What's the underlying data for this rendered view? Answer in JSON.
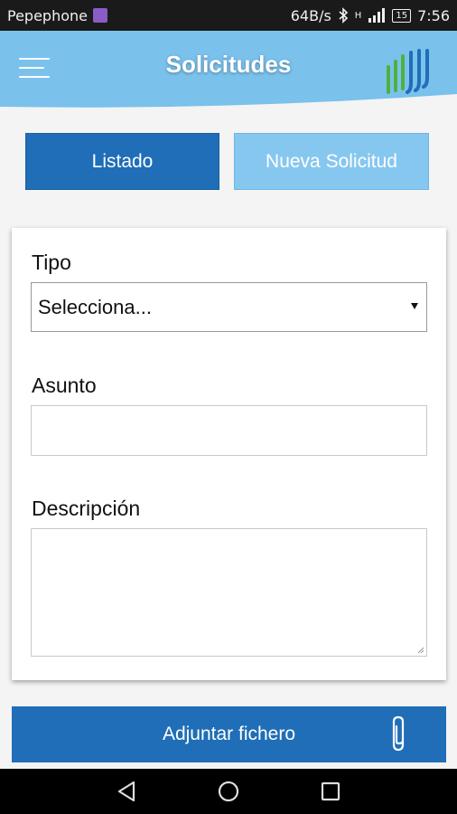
{
  "status_bar": {
    "carrier": "Pepephone",
    "net_speed": "64B/s",
    "network_type": "H",
    "battery": "15",
    "time": "7:56"
  },
  "header": {
    "title": "Solicitudes",
    "menu_icon": "hamburger-menu-icon",
    "logo": "brand-logo"
  },
  "tabs": [
    {
      "label": "Listado",
      "active": true
    },
    {
      "label": "Nueva Solicitud",
      "active": false
    }
  ],
  "form": {
    "tipo": {
      "label": "Tipo",
      "value": "Selecciona..."
    },
    "asunto": {
      "label": "Asunto",
      "value": ""
    },
    "descripcion": {
      "label": "Descripción",
      "value": ""
    }
  },
  "attach": {
    "label": "Adjuntar fichero",
    "icon": "paperclip-icon"
  },
  "colors": {
    "primary": "#1f6eb7",
    "secondary": "#86c7ef",
    "header": "#7ac1ec",
    "status_bar": "#1a1a1a"
  }
}
